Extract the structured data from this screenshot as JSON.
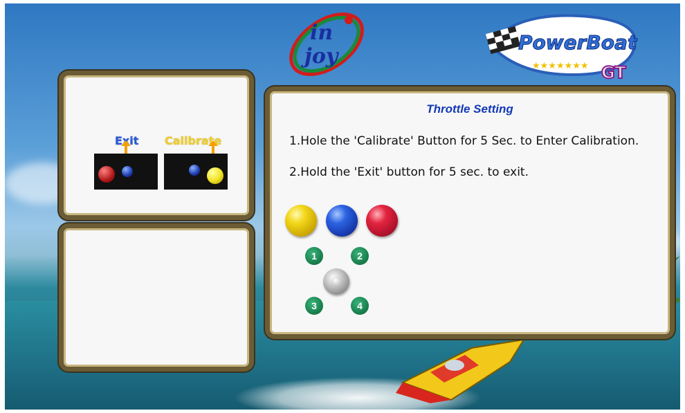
{
  "brand": {
    "publisher_logo_text": "in joy",
    "game_logo_text": "PowerBoat",
    "game_logo_suffix": "GT"
  },
  "hint_panel": {
    "exit_label": "Exit",
    "calibrate_label": "Calibrate"
  },
  "main_panel": {
    "title": "Throttle Setting",
    "instructions": [
      "1.Hole the 'Calibrate' Button for 5 Sec. to Enter Calibration.",
      "2.Hold the 'Exit' button for 5 sec. to exit."
    ],
    "buttons": [
      "yellow",
      "blue",
      "red"
    ],
    "positions": [
      "1",
      "2",
      "3",
      "4"
    ]
  },
  "colors": {
    "title": "#1238b6",
    "frame": "#6b5c35",
    "exit_label": "#2a5bd6",
    "calibrate_label": "#f0d030",
    "position_badge": "#167a48"
  },
  "icons": [
    "joystick-icon",
    "speedboat-icon"
  ]
}
